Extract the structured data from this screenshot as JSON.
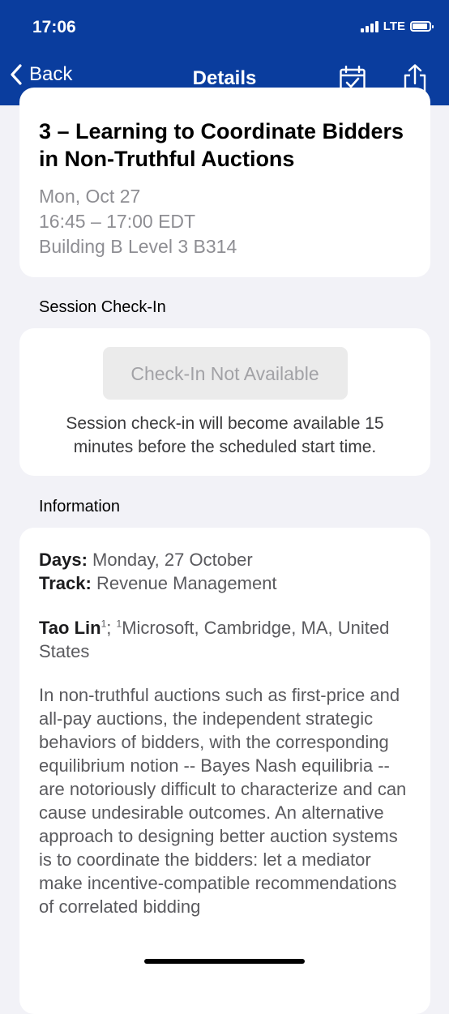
{
  "status_bar": {
    "time": "17:06",
    "network": "LTE"
  },
  "nav": {
    "back_label": "Back",
    "title": "Details",
    "calendar_icon": "calendar-check-icon",
    "share_icon": "share-icon"
  },
  "event": {
    "title": "3 – Learning to Coordinate Bidders in Non-Truthful Auctions",
    "date": "Mon, Oct 27",
    "time": "16:45 – 17:00 EDT",
    "location": "Building B Level 3 B314"
  },
  "checkin": {
    "section_label": "Session Check-In",
    "button_label": "Check-In Not Available",
    "note": "Session check-in will become available 15 minutes before the scheduled start time."
  },
  "information": {
    "section_label": "Information",
    "days_label": "Days:",
    "days_value": "Monday, 27 October",
    "track_label": "Track:",
    "track_value": "Revenue Management",
    "author_name": "Tao Lin",
    "author_sup": "1",
    "author_sep": "; ",
    "affiliation_sup": "1",
    "affiliation": "Microsoft, Cambridge, MA, United States",
    "abstract": "In non-truthful auctions such as first-price and all-pay auctions, the independent strategic behaviors of bidders, with the corresponding equilibrium notion -- Bayes Nash equilibria -- are notoriously difficult to characterize and can cause undesirable outcomes. An alternative approach to designing better auction systems is to coordinate the bidders: let a mediator make incentive-compatible recommendations of correlated bidding"
  },
  "colors": {
    "brand": "#0a3d9e",
    "background": "#f2f2f7",
    "muted_text": "#8e8e93"
  }
}
